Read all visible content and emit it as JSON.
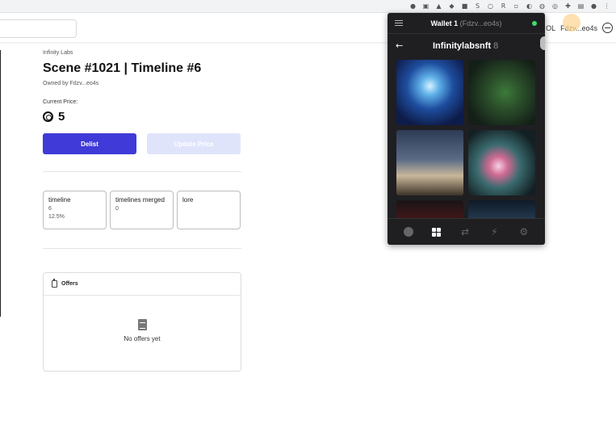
{
  "browser": {
    "extensions": [
      "●",
      "▣",
      "▲",
      "◆",
      "■",
      "S",
      "○",
      "R",
      "▫",
      "◐",
      "◍",
      "◎",
      "✚",
      "▤",
      "●",
      "⋮"
    ]
  },
  "header": {
    "currency_label": "OL",
    "account": "Fdzv...eo4s"
  },
  "item": {
    "collection": "Infinity Labs",
    "title": "Scene #1021 | Timeline #6",
    "owner": "Owned by Fdzv...eo4s",
    "price_label": "Current Price:",
    "price": "5",
    "delist_label": "Delist",
    "update_label": "Update Price"
  },
  "traits": [
    {
      "name": "timeline",
      "value": "6",
      "pct": "12.5%"
    },
    {
      "name": "timelines merged",
      "value": "0",
      "pct": ""
    },
    {
      "name": "lore",
      "value": "",
      "pct": ""
    }
  ],
  "offers": {
    "title": "Offers",
    "empty_text": "No offers yet"
  },
  "wallet": {
    "name": "Wallet 1",
    "address": "(Fdzv...eo4s)",
    "collection": "Infinitylabsnft",
    "count": "8",
    "status_color": "#3ddc6b",
    "back_icon": "←",
    "tabs": [
      "coin-icon",
      "collectibles-icon",
      "swap-icon",
      "activity-icon",
      "settings-icon"
    ],
    "tab_glyphs": {
      "swap": "⇄",
      "activity": "⚡",
      "settings": "⚙"
    }
  },
  "colors": {
    "primary": "#3f3ad8",
    "primary_disabled": "#e0e4fb",
    "wallet_bg": "#1f1f22"
  }
}
